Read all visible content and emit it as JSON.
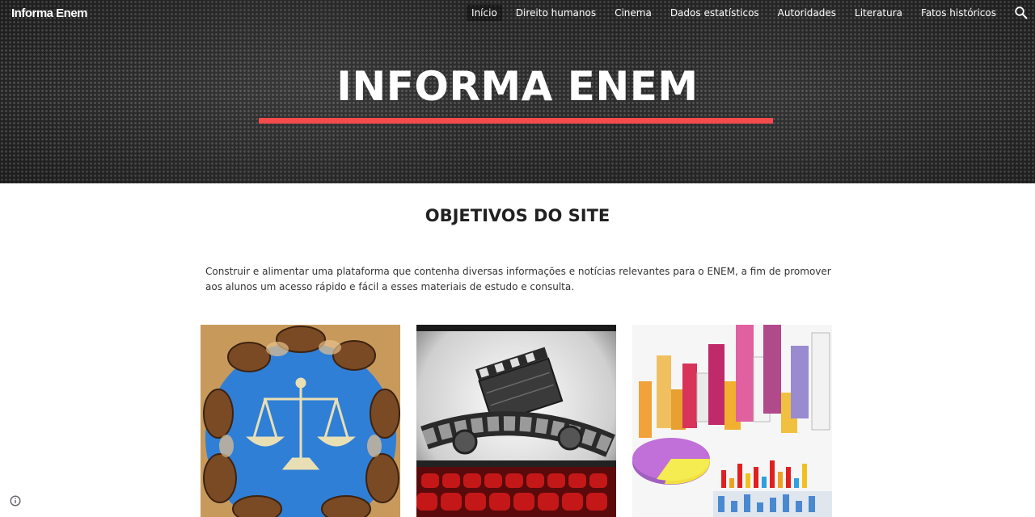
{
  "header": {
    "site_name": "Informa Enem",
    "nav_items": [
      {
        "label": "Início",
        "active": true
      },
      {
        "label": "Direito humanos",
        "active": false
      },
      {
        "label": "Cinema",
        "active": false
      },
      {
        "label": "Dados estatísticos",
        "active": false
      },
      {
        "label": "Autoridades",
        "active": false
      },
      {
        "label": "Literatura",
        "active": false
      },
      {
        "label": "Fatos históricos",
        "active": false
      }
    ],
    "search_icon": "search-icon"
  },
  "hero": {
    "title": "INFORMA ENEM",
    "underline_color": "#f44b4b"
  },
  "main": {
    "heading": "OBJETIVOS DO SITE",
    "description": "Construir e alimentar uma plataforma que contenha diversas informações e notícias relevantes para o ENEM, a fim de promover aos alunos um acesso rápido e fácil a esses materiais de estudo e consulta.",
    "cards": [
      {
        "name": "human-rights-image"
      },
      {
        "name": "cinema-image"
      },
      {
        "name": "statistics-image"
      }
    ]
  },
  "footer": {
    "info_icon": "info-icon"
  }
}
